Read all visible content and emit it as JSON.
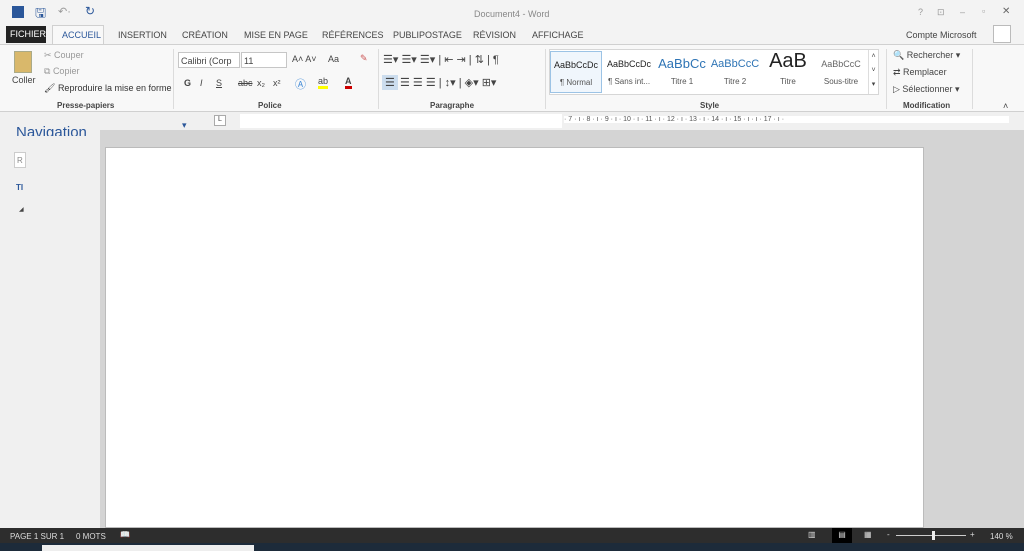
{
  "title": "Document4 - Word",
  "window_controls": [
    "?",
    "⊡",
    "–",
    "▫",
    "✕"
  ],
  "tabs": [
    "FICHIER",
    "ACCUEIL",
    "INSERTION",
    "CRÉATION",
    "MISE EN PAGE",
    "RÉFÉRENCES",
    "PUBLIPOSTAGE",
    "RÉVISION",
    "AFFICHAGE"
  ],
  "account": "Compte Microsoft",
  "clipboard": {
    "paste": "Coller",
    "cut": "Couper",
    "copy": "Copier",
    "format_painter": "Reproduire la mise en forme",
    "label": "Presse-papiers"
  },
  "font": {
    "name": "Calibri (Corp",
    "size": "11",
    "label": "Police",
    "bold": "G",
    "italic": "I",
    "underline": "S",
    "strike": "abc",
    "sub": "x₂",
    "sup": "x²",
    "case": "Aa"
  },
  "paragraph": {
    "label": "Paragraphe"
  },
  "styles": {
    "label": "Style",
    "items": [
      {
        "preview": "AaBbCcDc",
        "name": "¶ Normal"
      },
      {
        "preview": "AaBbCcDc",
        "name": "¶ Sans int..."
      },
      {
        "preview": "AaBbCc",
        "name": "Titre 1"
      },
      {
        "preview": "AaBbCcC",
        "name": "Titre 2"
      },
      {
        "preview": "AaB",
        "name": "Titre"
      },
      {
        "preview": "AaBbCcC",
        "name": "Sous-titre"
      }
    ]
  },
  "editing": {
    "find": "Rechercher",
    "replace": "Remplacer",
    "select": "Sélectionner",
    "label": "Modification"
  },
  "ruler": "· 7 · ı · 8 · ı · 9 · ı · 10 · ı · 11 · ı · 12 · ı · 13 · ı · 14 · ı · 15 · ı · ı · 17 · ı ·",
  "nav": {
    "title": "Navigation",
    "search": "R",
    "tab": "TI"
  },
  "status": {
    "page": "PAGE 1 SUR 1",
    "words": "0 MOTS",
    "zoom": "140 %"
  },
  "colors": {
    "accent": "#2b579a",
    "status_bg": "#2d2d2d"
  }
}
